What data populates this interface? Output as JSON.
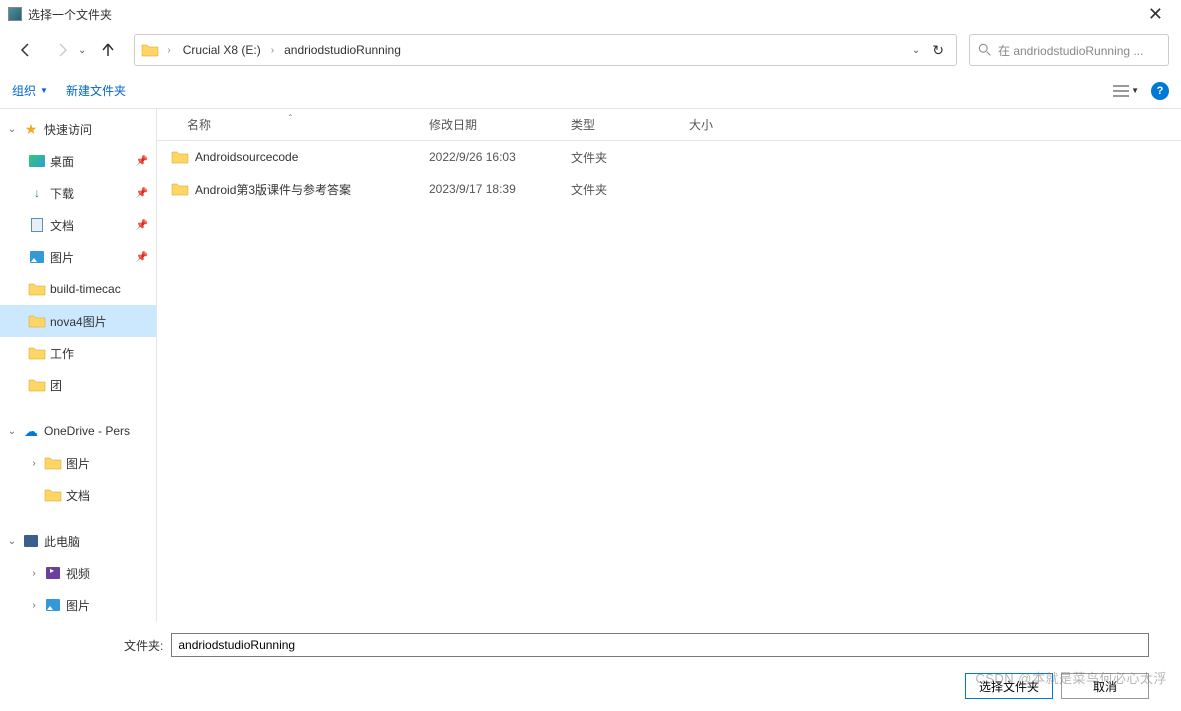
{
  "title": "选择一个文件夹",
  "breadcrumb": {
    "items": [
      "Crucial X8 (E:)",
      "andriodstudioRunning"
    ]
  },
  "search": {
    "placeholder": "在 andriodstudioRunning ..."
  },
  "toolbar": {
    "organize": "组织",
    "new_folder": "新建文件夹"
  },
  "sidebar": {
    "quick_access": "快速访问",
    "desktop": "桌面",
    "downloads": "下载",
    "documents": "文档",
    "pictures": "图片",
    "build_timecache": "build-timecac",
    "nova4": "nova4图片",
    "work": "工作",
    "tuan": "团",
    "onedrive": "OneDrive - Pers",
    "od_pictures": "图片",
    "od_documents": "文档",
    "this_pc": "此电脑",
    "videos": "视频",
    "pc_pictures": "图片"
  },
  "columns": {
    "name": "名称",
    "date": "修改日期",
    "type": "类型",
    "size": "大小"
  },
  "files": [
    {
      "name": "Androidsourcecode",
      "date": "2022/9/26 16:03",
      "type": "文件夹"
    },
    {
      "name": "Android第3版课件与参考答案",
      "date": "2023/9/17 18:39",
      "type": "文件夹"
    }
  ],
  "footer": {
    "folder_label": "文件夹:",
    "folder_value": "andriodstudioRunning",
    "select_btn": "选择文件夹",
    "cancel_btn": "取消"
  },
  "watermark": "CSDN @本就是菜鸟何必心太浮"
}
